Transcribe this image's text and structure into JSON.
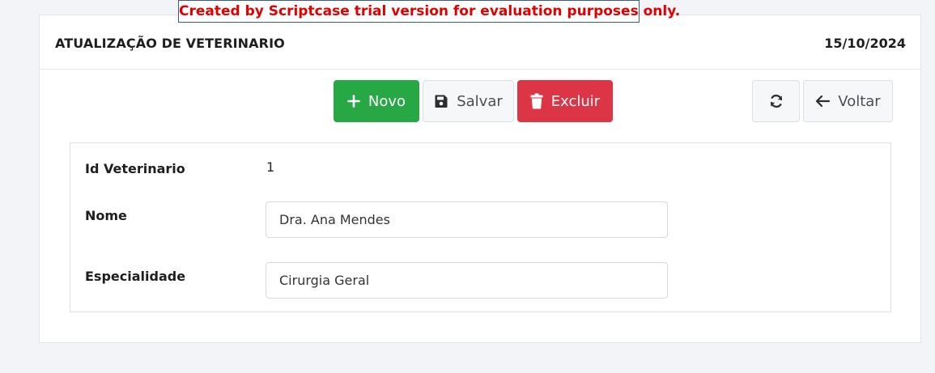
{
  "trial_banner": "Created by Scriptcase trial version for evaluation purposes only.",
  "header": {
    "title": "ATUALIZAÇÃO DE VETERINARIO",
    "date": "15/10/2024"
  },
  "toolbar": {
    "new_label": "Novo",
    "save_label": "Salvar",
    "delete_label": "Excluir",
    "back_label": "Voltar",
    "icons": {
      "new": "plus-icon",
      "save": "floppy-disk-icon",
      "delete": "trash-icon",
      "refresh": "refresh-icon",
      "back": "arrow-left-icon"
    }
  },
  "form": {
    "id_label": "Id Veterinario",
    "id_value": "1",
    "nome_label": "Nome",
    "nome_value": "Dra. Ana Mendes",
    "especialidade_label": "Especialidade",
    "especialidade_value": "Cirurgia Geral"
  },
  "colors": {
    "success": "#28a745",
    "danger": "#dc3545",
    "banner_text": "#e00000",
    "background": "#f3f4f7"
  }
}
